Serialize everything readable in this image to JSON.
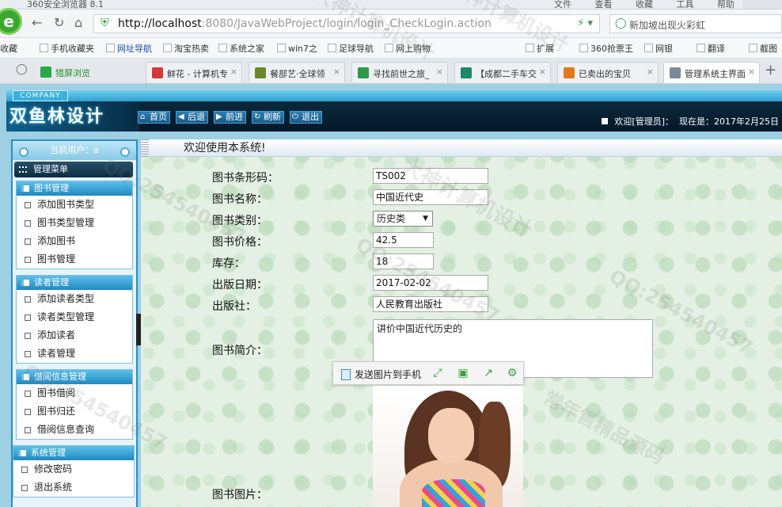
{
  "browser": {
    "title": "360安全浏览器 8.1",
    "menu": [
      "文件",
      "查看",
      "收藏",
      "工具",
      "帮助"
    ],
    "url_host": "http://localhost",
    "url_rest": ":8080/JavaWebProject/login/login_CheckLogin.action",
    "search_text": "新加坡出现火彩虹",
    "bookmarks": [
      "收藏",
      "手机收藏夹",
      "网址导航",
      "淘宝热卖",
      "系统之家",
      "win7之",
      "足球导航",
      "网上购物",
      "扩展",
      "360抢票王",
      "网银",
      "翻译",
      "截图"
    ],
    "tabs": [
      {
        "label": "猎屏浏览",
        "color": "#2aa84a"
      },
      {
        "label": "鲜花 - 计算机专",
        "color": "#d23a3a"
      },
      {
        "label": "餐部艺·全球领",
        "color": "#6a8a2a"
      },
      {
        "label": "寻找前世之旅_",
        "color": "#2a9a4a"
      },
      {
        "label": "【成都二手车交",
        "color": "#1a8a6a"
      },
      {
        "label": "已卖出的宝贝",
        "color": "#e07a1a"
      },
      {
        "label": "管理系统主界面",
        "color": "#7a8a9a"
      }
    ]
  },
  "app": {
    "company": "COMPANY",
    "brand": "双鱼林设计",
    "toolbar": [
      "首页",
      "后退",
      "前进",
      "刷新",
      "退出"
    ],
    "welcome": "欢迎[管理员]：",
    "date": "现在是：2017年2月25日",
    "current_user": "当前用户：a",
    "menu_head": "管理菜单",
    "groups": [
      {
        "title": "图书管理",
        "items": [
          "添加图书类型",
          "图书类型管理",
          "添加图书",
          "图书管理"
        ]
      },
      {
        "title": "读者管理",
        "items": [
          "添加读者类型",
          "读者类型管理",
          "添加读者",
          "读者管理"
        ]
      },
      {
        "title": "借阅信息管理",
        "items": [
          "图书借阅",
          "图书归还",
          "借阅信息查询"
        ]
      },
      {
        "title": "系统管理",
        "items": [
          "修改密码",
          "退出系统"
        ]
      }
    ],
    "main_title": "欢迎使用本系统!",
    "form": {
      "barcode_label": "图书条形码：",
      "barcode": "TS002",
      "name_label": "图书名称：",
      "name": "中国近代史",
      "type_label": "图书类别：",
      "type": "历史类",
      "price_label": "图书价格：",
      "price": "42.5",
      "stock_label": "库存：",
      "stock": "18",
      "pubdate_label": "出版日期：",
      "pubdate": "2017-02-02",
      "publisher_label": "出版社：",
      "publisher": "人民教育出版社",
      "intro_label": "图书简介：",
      "intro": "讲价中国近代历史的",
      "photo_label": "图书图片："
    },
    "image_toolbar_send": "发送图片到手机"
  },
  "watermarks": [
    "大神计算机设计",
    "QQ:254540457",
    "常年售精品源码"
  ]
}
